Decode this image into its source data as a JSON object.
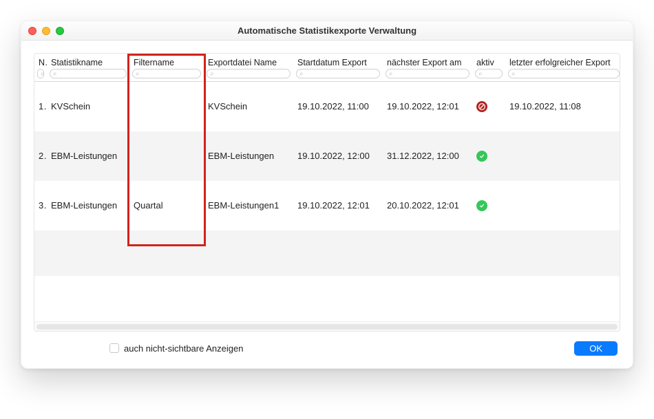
{
  "window": {
    "title": "Automatische Statistikexporte Verwaltung"
  },
  "table": {
    "columns": {
      "n": "N",
      "statistikname": "Statistikname",
      "filtername": "Filtername",
      "exportdatei": "Exportdatei Name",
      "startdatum": "Startdatum Export",
      "naechster": "nächster Export am",
      "aktiv": "aktiv",
      "letzter": "letzter erfolgreicher Export"
    },
    "rows": [
      {
        "n": "1",
        "statistikname": "KVSchein",
        "filtername": "",
        "exportdatei": "KVSchein",
        "startdatum": "19.10.2022, 11:00",
        "naechster": "19.10.2022, 12:01",
        "aktiv": "inactive",
        "letzter": "19.10.2022, 11:08"
      },
      {
        "n": "2",
        "statistikname": "EBM-Leistungen",
        "filtername": "",
        "exportdatei": "EBM-Leistungen",
        "startdatum": "19.10.2022, 12:00",
        "naechster": "31.12.2022, 12:00",
        "aktiv": "active",
        "letzter": ""
      },
      {
        "n": "3",
        "statistikname": "EBM-Leistungen",
        "filtername": "Quartal",
        "exportdatei": "EBM-Leistungen1",
        "startdatum": "19.10.2022, 12:01",
        "naechster": "20.10.2022, 12:01",
        "aktiv": "active",
        "letzter": ""
      }
    ]
  },
  "footer": {
    "checkbox_label": "auch nicht-sichtbare Anzeigen",
    "ok_label": "OK"
  },
  "annotation": {
    "highlight_column": "filtername"
  },
  "colors": {
    "highlight_border": "#d1221c",
    "status_active": "#34c759",
    "status_inactive": "#b4241f",
    "primary_button": "#0a7aff"
  }
}
